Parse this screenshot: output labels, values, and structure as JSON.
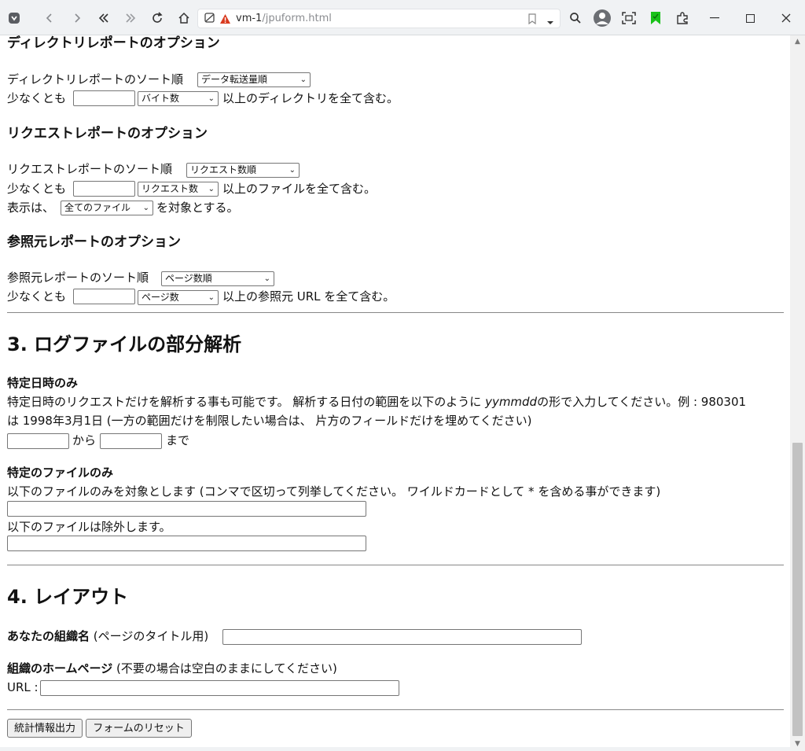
{
  "browser": {
    "url_host": "vm-1",
    "url_path": "/jpuform.html"
  },
  "dir_report": {
    "heading": "ディレクトリレポートのオプション",
    "sort_label": "ディレクトリレポートのソート順",
    "sort_value": "データ転送量順",
    "min_prefix": "少なくとも",
    "min_value": "",
    "unit_value": "バイト数",
    "min_suffix": "以上のディレクトリを全て含む。"
  },
  "req_report": {
    "heading": "リクエストレポートのオプション",
    "sort_label": "リクエストレポートのソート順",
    "sort_value": "リクエスト数順",
    "min_prefix": "少なくとも",
    "min_value": "",
    "unit_value": "リクエスト数",
    "min_suffix": "以上のファイルを全て含む。",
    "show_prefix": "表示は、",
    "show_value": "全てのファイル",
    "show_suffix": "を対象とする。"
  },
  "ref_report": {
    "heading": "参照元レポートのオプション",
    "sort_label": "参照元レポートのソート順",
    "sort_value": "ページ数順",
    "min_prefix": "少なくとも",
    "min_value": "",
    "unit_value": "ページ数",
    "min_suffix": "以上の参照元 URL を全て含む。"
  },
  "section3": {
    "title": "3. ログファイルの部分解析",
    "date_heading": "特定日時のみ",
    "date_text_1": "特定日時のリクエストだけを解析する事も可能です。 解析する日付の範囲を以下のように",
    "date_format": "yymmdd",
    "date_text_2": "の形で入力してください。例 : 980301",
    "date_text_3": "は 1998年3月1日 (一方の範囲だけを制限したい場合は、 片方のフィールドだけを埋めてください)",
    "from_label": "から",
    "to_label": "まで",
    "from_value": "",
    "to_value": "",
    "file_heading": "特定のファイルのみ",
    "include_text": "以下のファイルのみを対象とします (コンマで区切って列挙してください。 ワイルドカードとして * を含める事ができます)",
    "include_value": "",
    "exclude_text": "以下のファイルは除外します。",
    "exclude_value": ""
  },
  "section4": {
    "title": "4. レイアウト",
    "org_label_bold": "あなたの組織名",
    "org_label_note": "(ページのタイトル用)",
    "org_value": "",
    "home_label_bold": "組織のホームページ",
    "home_label_note": "(不要の場合は空白のままにしてください)",
    "url_label": "URL :",
    "url_value": ""
  },
  "buttons": {
    "submit": "統計情報出力",
    "reset": "フォームのリセット"
  }
}
